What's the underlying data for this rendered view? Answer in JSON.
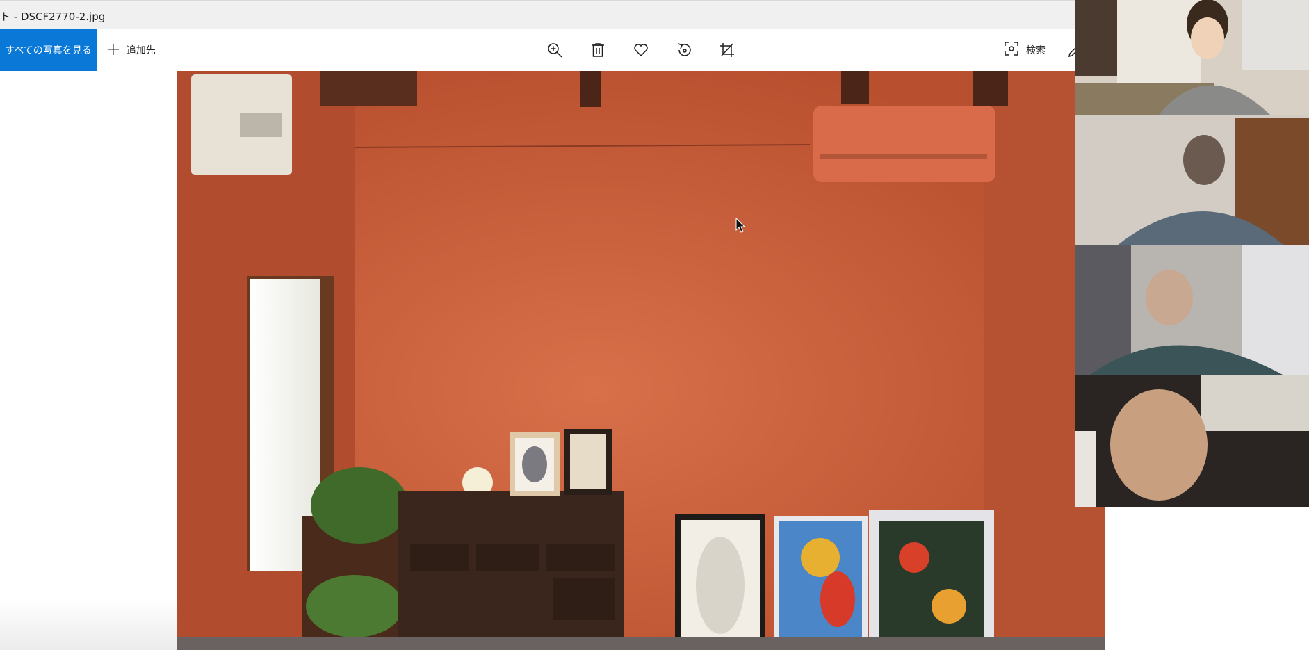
{
  "window": {
    "title": "ト - DSCF2770-2.jpg"
  },
  "toolbar": {
    "see_all_label": "すべての写真を見る",
    "add_to_label": "追加先",
    "search_label": "検索",
    "icons": [
      "zoom-in-icon",
      "delete-icon",
      "favorite-icon",
      "rotate-icon",
      "crop-icon",
      "visual-search-icon",
      "edit-icon"
    ]
  },
  "photo": {
    "file_name": "DSCF2770-2.jpg",
    "wall_color": "#c35a37"
  },
  "video_call": {
    "participant_count": 4
  },
  "colors": {
    "accent": "#0a78d7",
    "titlebar_bg": "#f0f0f0"
  }
}
